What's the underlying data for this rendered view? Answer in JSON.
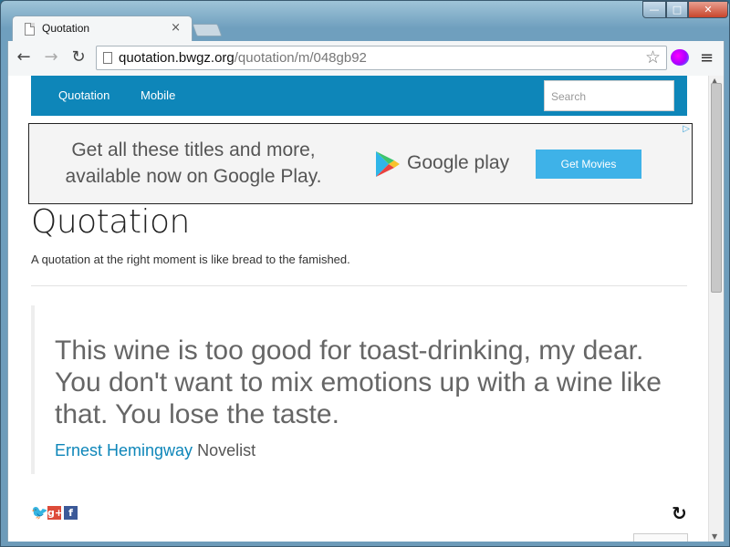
{
  "browser": {
    "tab_title": "Quotation",
    "tab_close": "×",
    "url_domain": "quotation.bwgz.org",
    "url_path": "/quotation/m/048gb92",
    "back": "←",
    "forward": "→",
    "reload": "↻",
    "star": "☆",
    "menu": "≡",
    "window_min": "—",
    "window_max": "□",
    "window_close": "✕"
  },
  "site_nav": {
    "links": [
      "Quotation",
      "Mobile"
    ],
    "search_placeholder": "Search"
  },
  "ad": {
    "text_line1": "Get all these titles and more,",
    "text_line2": "available now on Google Play.",
    "brand": "Google play",
    "button": "Get Movies",
    "adchoices": "▷"
  },
  "page": {
    "title": "Quotation",
    "tagline": "A quotation at the right moment is like bread to the famished."
  },
  "quote": {
    "text": "This wine is too good for toast-drinking, my dear. You don't want to mix emotions up with a wine like that. You lose the taste.",
    "author": "Ernest Hemingway",
    "role": "Novelist"
  },
  "social": {
    "twitter": "t",
    "google_plus": "g+",
    "facebook": "f"
  },
  "refresh_icon": "↻",
  "colors": {
    "nav_bg": "#0e86b9",
    "link": "#0e86b9",
    "ad_button": "#3eb2e8"
  }
}
